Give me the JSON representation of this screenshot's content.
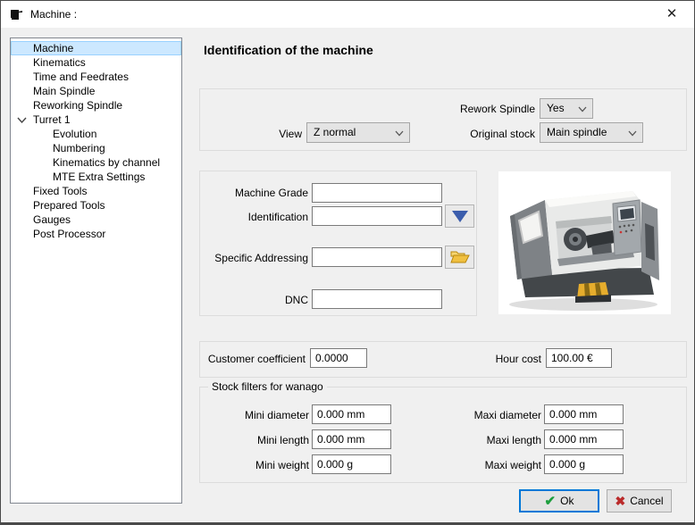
{
  "window": {
    "title": "Machine :"
  },
  "icons": {
    "close": "✕",
    "check": "✔",
    "cross": "✖"
  },
  "sidebar": {
    "items": [
      {
        "label": "Machine",
        "selected": true
      },
      {
        "label": "Kinematics"
      },
      {
        "label": "Time and Feedrates"
      },
      {
        "label": "Main Spindle"
      },
      {
        "label": "Reworking Spindle"
      },
      {
        "label": "Turret 1",
        "expanded": true
      },
      {
        "label": "Evolution",
        "child": true
      },
      {
        "label": "Numbering",
        "child": true
      },
      {
        "label": "Kinematics by channel",
        "child": true
      },
      {
        "label": "MTE Extra Settings",
        "child": true
      },
      {
        "label": "Fixed Tools"
      },
      {
        "label": "Prepared Tools"
      },
      {
        "label": "Gauges"
      },
      {
        "label": "Post Processor"
      }
    ]
  },
  "main": {
    "heading": "Identification of the machine",
    "view_group": {
      "rework_spindle_label": "Rework Spindle",
      "rework_spindle_value": "Yes",
      "view_label": "View",
      "view_value": "Z normal",
      "original_stock_label": "Original stock",
      "original_stock_value": "Main spindle"
    },
    "id_group": {
      "machine_grade_label": "Machine Grade",
      "machine_grade_value": "",
      "identification_label": "Identification",
      "identification_value": "",
      "specific_addressing_label": "Specific Addressing",
      "specific_addressing_value": "",
      "dnc_label": "DNC",
      "dnc_value": ""
    },
    "cost_group": {
      "customer_coefficient_label": "Customer coefficient",
      "customer_coefficient_value": "0.0000",
      "hour_cost_label": "Hour cost",
      "hour_cost_value": "100.00 €"
    },
    "stock_group": {
      "title": "Stock filters for wanago",
      "fields": [
        {
          "label": "Mini diameter",
          "value": "0.000 mm"
        },
        {
          "label": "Maxi diameter",
          "value": "0.000 mm"
        },
        {
          "label": "Mini length",
          "value": "0.000 mm"
        },
        {
          "label": "Maxi length",
          "value": "0.000 mm"
        },
        {
          "label": "Mini weight",
          "value": "0.000 g"
        },
        {
          "label": "Maxi weight",
          "value": "0.000 g"
        }
      ]
    }
  },
  "footer": {
    "ok_label": "Ok",
    "cancel_label": "Cancel"
  },
  "colors": {
    "accent_focus": "#0078d7",
    "selection_bg": "#cce8ff",
    "selection_border": "#99d1ff",
    "ok_check_green": "#1e9e3e",
    "cancel_x_red": "#ba2a2a",
    "dropdown_triangle_blue": "#3b5dac",
    "folder_yellow": "#f0c040"
  }
}
